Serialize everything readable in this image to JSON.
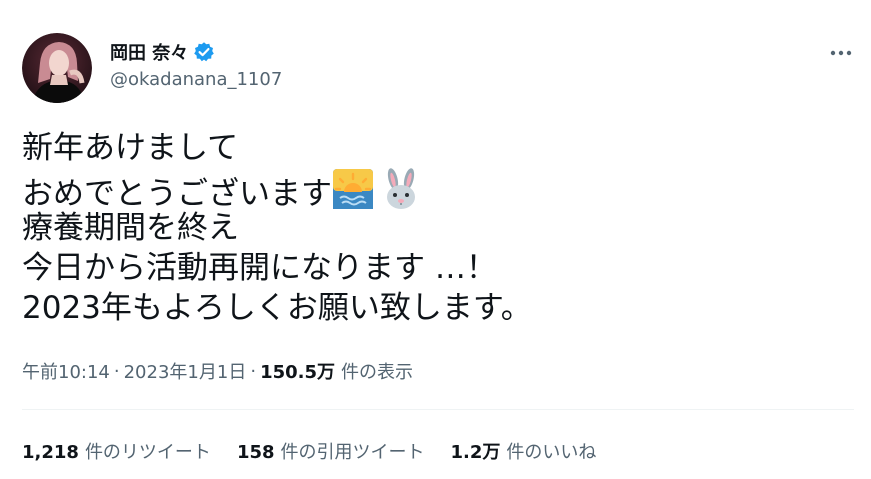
{
  "user": {
    "display_name": "岡田 奈々",
    "handle": "@okadanana_1107",
    "verified": true
  },
  "tweet": {
    "lines": [
      "新年あけまして",
      "おめでとうございます",
      "療養期間を終え",
      "今日から活動再開になります …！",
      "2023年もよろしくお願い致します。"
    ],
    "emojis": [
      "sunrise-over-water",
      "rabbit-face"
    ],
    "time": "午前10:14",
    "separator": "·",
    "date": "2023年1月1日",
    "views_count": "150.5万",
    "views_label": "件の表示"
  },
  "stats": {
    "retweets_count": "1,218",
    "retweets_label": "件のリツイート",
    "quotes_count": "158",
    "quotes_label": "件の引用ツイート",
    "likes_count": "1.2万",
    "likes_label": "件のいいね"
  },
  "colors": {
    "text_primary": "#0f1419",
    "text_secondary": "#536471",
    "verified_blue": "#1d9bf0",
    "divider": "#eff3f4"
  }
}
